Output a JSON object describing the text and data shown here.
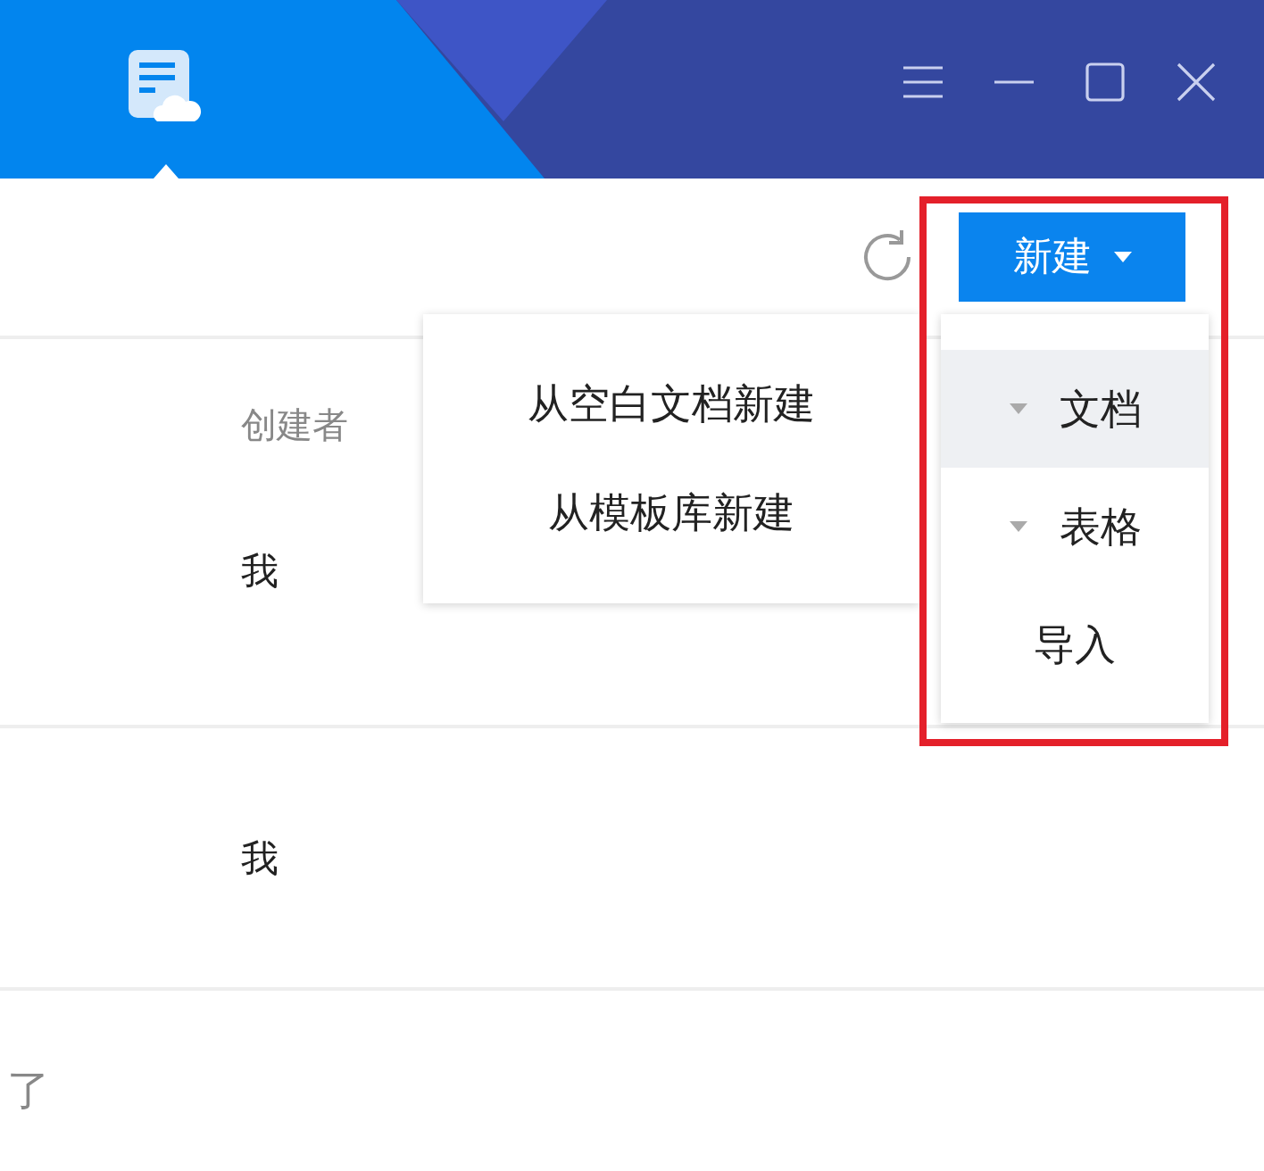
{
  "toolbar": {
    "new_button": "新建",
    "new_menu_open": true
  },
  "new_menu": [
    {
      "label": "文档",
      "kind": "submenu",
      "selected": true
    },
    {
      "label": "表格",
      "kind": "submenu",
      "selected": false
    },
    {
      "label": "导入",
      "kind": "plain",
      "selected": false
    }
  ],
  "submenu": [
    "从空白文档新建",
    "从模板库新建"
  ],
  "table": {
    "columns": [
      "创建者"
    ],
    "rows": [
      [
        "我"
      ],
      [
        "我"
      ]
    ]
  },
  "footer_text": "了",
  "annotation": {
    "kind": "box"
  }
}
